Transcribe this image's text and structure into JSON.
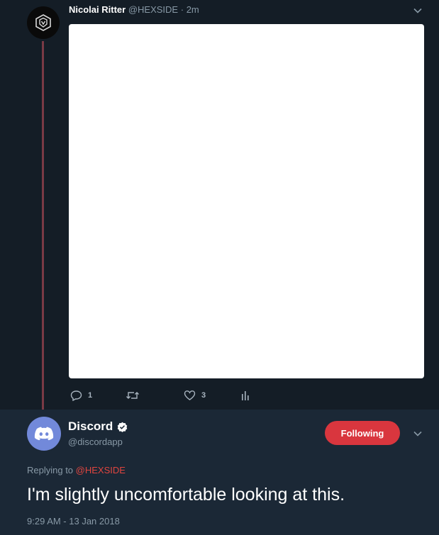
{
  "parent_tweet": {
    "author_name": "Nicolai Ritter",
    "author_handle": "@HEXSIDE",
    "separator": "·",
    "time": "2m",
    "actions": {
      "reply_count": "1",
      "retweet_count": "",
      "like_count": "3"
    }
  },
  "focused_tweet": {
    "author_name": "Discord",
    "author_handle": "@discordapp",
    "follow_label": "Following",
    "replying_prefix": "Replying to",
    "replying_mention": "@HEXSIDE",
    "text": "I'm slightly uncomfortable looking at this.",
    "timestamp": "9:29 AM - 13 Jan 2018"
  },
  "colors": {
    "background": "#141d26",
    "focus_background": "#1b2836",
    "thread_line": "#7a3a45",
    "follow_button": "#d9363e",
    "mention": "#e2453f",
    "discord_blurple": "#7289da"
  },
  "icons": {
    "parent_avatar": "hexside-logo-icon",
    "menu": "chevron-down-icon",
    "reply": "reply-icon",
    "retweet": "retweet-icon",
    "like": "heart-icon",
    "analytics": "analytics-icon",
    "verified": "verified-badge-icon",
    "discord_avatar": "discord-logo-icon"
  }
}
